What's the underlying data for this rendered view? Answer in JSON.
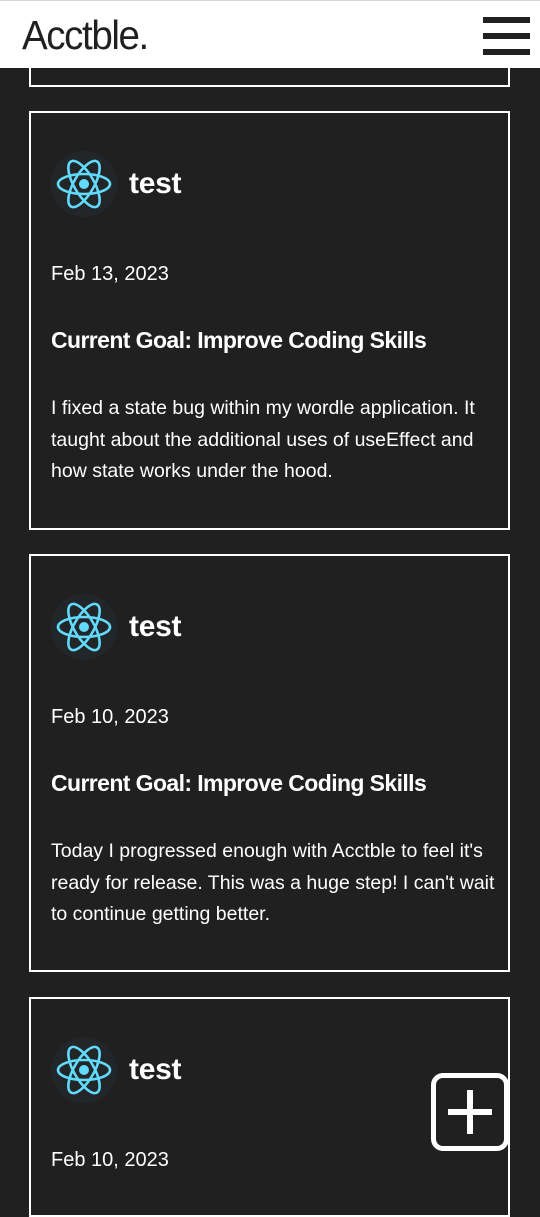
{
  "app": {
    "logo_text": "Acctble."
  },
  "header": {
    "menu_icon": "hamburger-menu-icon"
  },
  "posts": [
    {
      "author": "test",
      "avatar_icon": "react-logo-icon",
      "date": "Feb 13, 2023",
      "goal": "Current Goal: Improve Coding Skills",
      "text": "I fixed a state bug within my wordle application. It taught about the additional uses of useEffect and how state works under the hood."
    },
    {
      "author": "test",
      "avatar_icon": "react-logo-icon",
      "date": "Feb 10, 2023",
      "goal": "Current Goal: Improve Coding Skills",
      "text": "Today I progressed enough with Acctble to feel it's ready for release. This was a huge step! I can't wait to continue getting better."
    },
    {
      "author": "test",
      "avatar_icon": "react-logo-icon",
      "date": "Feb 10, 2023"
    }
  ],
  "fab": {
    "icon": "plus-icon"
  },
  "colors": {
    "background": "#202020",
    "header": "#ffffff",
    "react_cyan": "#61dafb"
  }
}
